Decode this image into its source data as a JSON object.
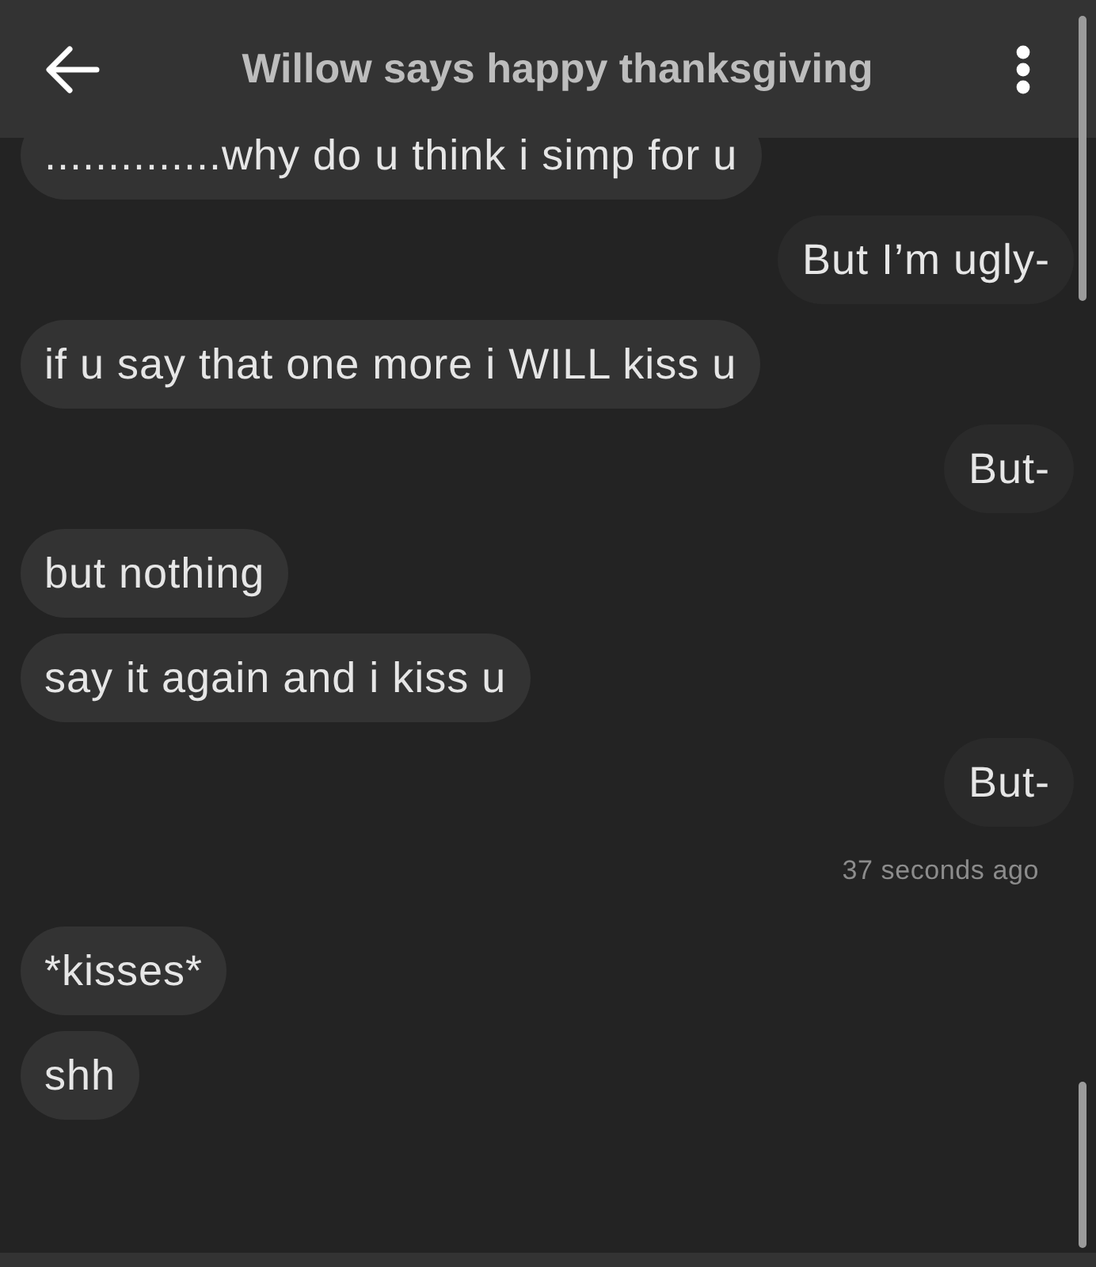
{
  "header": {
    "title": "Willow says happy thanksgiving"
  },
  "messages": [
    {
      "kind": "received",
      "text": "..............why do u think i simp for u"
    },
    {
      "kind": "sent",
      "text": "But I’m ugly-"
    },
    {
      "kind": "received",
      "text": "if u say that one more i WILL kiss u"
    },
    {
      "kind": "sent",
      "text": "But-"
    },
    {
      "kind": "received",
      "text": "but nothing"
    },
    {
      "kind": "received",
      "text": "say it again and i kiss u"
    },
    {
      "kind": "sent",
      "text": "But-"
    },
    {
      "kind": "timestamp",
      "text": "37 seconds ago"
    },
    {
      "kind": "received",
      "text": "*kisses*"
    },
    {
      "kind": "received",
      "text": "shh"
    }
  ]
}
